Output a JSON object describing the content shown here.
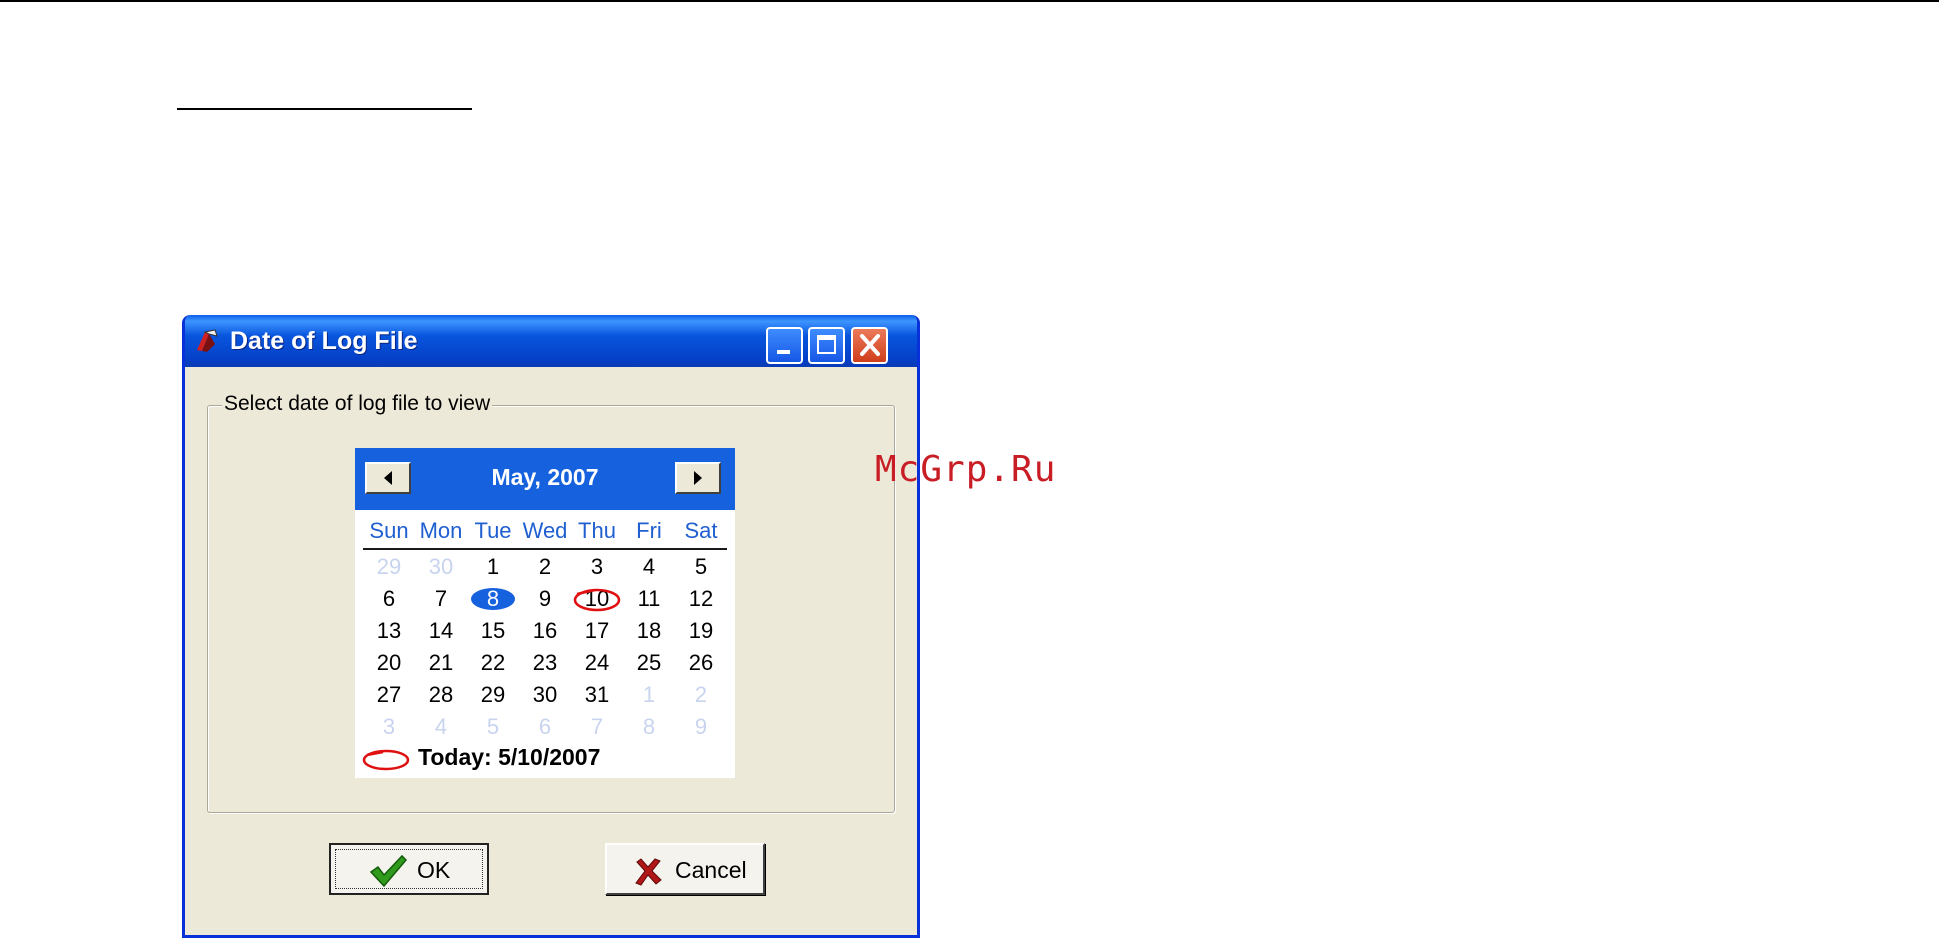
{
  "window": {
    "title": "Date of Log File",
    "controls": [
      "minimize-icon",
      "maximize-icon",
      "close-icon"
    ]
  },
  "group": {
    "label": "Select date of log file to view"
  },
  "calendar": {
    "month_label": "May, 2007",
    "weekdays": [
      "Sun",
      "Mon",
      "Tue",
      "Wed",
      "Thu",
      "Fri",
      "Sat"
    ],
    "weeks": [
      [
        "29",
        "30",
        "1",
        "2",
        "3",
        "4",
        "5"
      ],
      [
        "6",
        "7",
        "8",
        "9",
        "10",
        "11",
        "12"
      ],
      [
        "13",
        "14",
        "15",
        "16",
        "17",
        "18",
        "19"
      ],
      [
        "20",
        "21",
        "22",
        "23",
        "24",
        "25",
        "26"
      ],
      [
        "27",
        "28",
        "29",
        "30",
        "31",
        "1",
        "2"
      ],
      [
        "3",
        "4",
        "5",
        "6",
        "7",
        "8",
        "9"
      ]
    ],
    "selected_day": "8",
    "today_day": "10",
    "today_text": "Today: 5/10/2007",
    "header_color": "#1561de",
    "weekday_color": "#1f5fd0",
    "today_mark_color": "#e01010",
    "outside_day_color": "#c8d4ee"
  },
  "buttons": {
    "ok_label": "OK",
    "cancel_label": "Cancel"
  },
  "watermark": "McGrp.Ru"
}
